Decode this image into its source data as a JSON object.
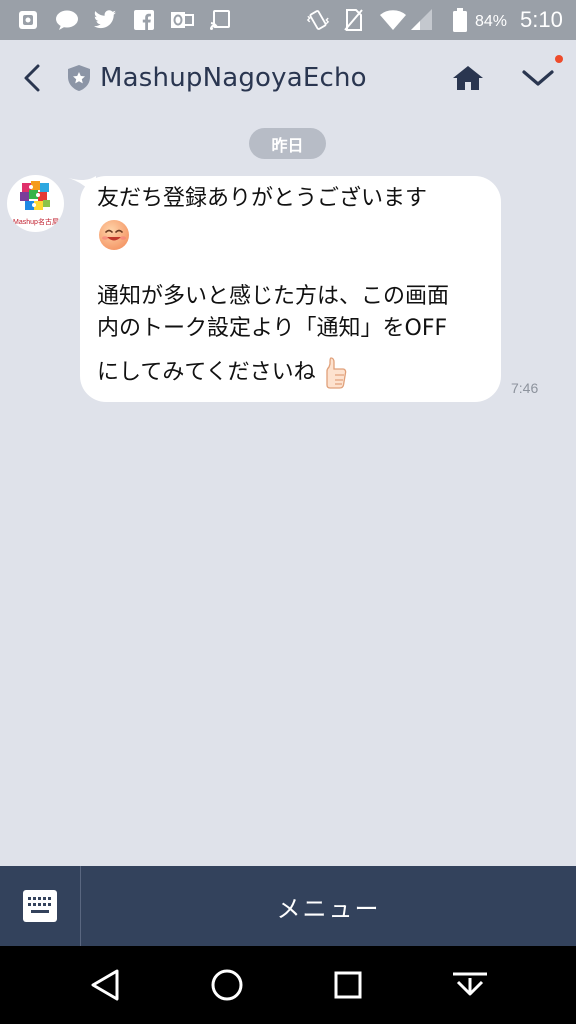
{
  "status_bar": {
    "battery": "84%",
    "time": "5:10",
    "left_icons": [
      "app-notification-icon",
      "chat-bubble-icon",
      "twitter-icon",
      "facebook-icon",
      "outlook-icon",
      "cast-icon"
    ],
    "right_icons": [
      "vibrate-icon",
      "sim-off-icon",
      "wifi-icon",
      "signal-icon",
      "battery-icon"
    ]
  },
  "header": {
    "title": "MashupNagoyaEcho",
    "back_icon": "back-chevron-icon",
    "badge_icon": "official-shield-star-icon",
    "home_icon": "home-icon",
    "menu_icon": "chevron-down-icon",
    "accent_color": "#2a3650",
    "notification_dot_color": "#ee4b2b"
  },
  "chat": {
    "date_label": "昨日",
    "sender_avatar_caption": "Mashup名古屋",
    "message": {
      "line1": "友だち登録ありがとうございます",
      "line2": "通知が多いと感じた方は、この画面",
      "line3": "内のトーク設定より「通知」をOFF",
      "line4": "にしてみてくださいね",
      "emoji1": "smiling-face-icon",
      "emoji2": "thumbs-up-icon"
    },
    "timestamp": "7:46"
  },
  "bottom_bar": {
    "keyboard_icon": "keyboard-icon",
    "menu_label": "メニュー",
    "background_color": "#33425c"
  },
  "nav_bar": {
    "icons": [
      "back-triangle-icon",
      "home-circle-icon",
      "recents-square-icon",
      "hide-keyboard-icon"
    ]
  }
}
